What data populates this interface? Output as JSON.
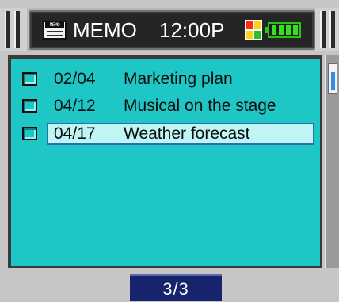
{
  "header": {
    "app_icon_label": "MEMO",
    "title": "MEMO",
    "time": "12:00P",
    "battery_cells": 4
  },
  "memos": [
    {
      "date": "02/04",
      "title": "Marketing plan",
      "checked": false,
      "selected": false
    },
    {
      "date": "04/12",
      "title": "Musical on the stage",
      "checked": false,
      "selected": false
    },
    {
      "date": "04/17",
      "title": "Weather forecast",
      "checked": false,
      "selected": true
    }
  ],
  "pager": {
    "label": "3/3"
  },
  "colors": {
    "list_background": "#1fc6c6",
    "title_panel": "#252525",
    "pager_background": "#17246b",
    "selection_fill": "#bff5f5",
    "selection_border": "#2a6fae",
    "battery": "#36e01e"
  }
}
